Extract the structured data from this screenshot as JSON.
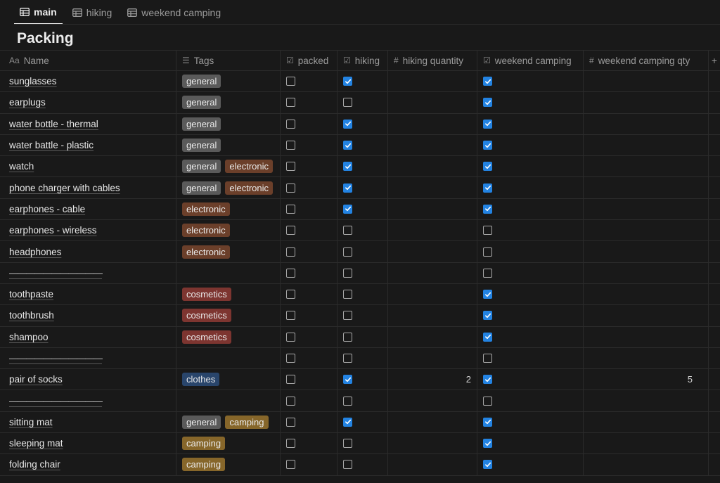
{
  "tabs": [
    {
      "label": "main",
      "icon": "table-icon"
    },
    {
      "label": "hiking",
      "icon": "table-icon"
    },
    {
      "label": "weekend camping",
      "icon": "table-icon"
    }
  ],
  "page": {
    "title": "Packing"
  },
  "columns": {
    "name": "Name",
    "name_icon": "Aa",
    "tags": "Tags",
    "packed": "packed",
    "hiking": "hiking",
    "hiking_qty": "hiking quantity",
    "weekend_camping": "weekend camping",
    "weekend_camping_qty": "weekend camping qty",
    "add": "+"
  },
  "rows": [
    {
      "name": "sunglasses",
      "tags": [
        "general"
      ],
      "packed": false,
      "hiking": true,
      "hiking_qty": "",
      "weekend_camping": true,
      "weekend_camping_qty": ""
    },
    {
      "name": "earplugs",
      "tags": [
        "general"
      ],
      "packed": false,
      "hiking": false,
      "hiking_qty": "",
      "weekend_camping": true,
      "weekend_camping_qty": ""
    },
    {
      "name": "water bottle - thermal",
      "tags": [
        "general"
      ],
      "packed": false,
      "hiking": true,
      "hiking_qty": "",
      "weekend_camping": true,
      "weekend_camping_qty": ""
    },
    {
      "name": "water battle - plastic",
      "tags": [
        "general"
      ],
      "packed": false,
      "hiking": true,
      "hiking_qty": "",
      "weekend_camping": true,
      "weekend_camping_qty": ""
    },
    {
      "name": "watch",
      "tags": [
        "general",
        "electronic"
      ],
      "packed": false,
      "hiking": true,
      "hiking_qty": "",
      "weekend_camping": true,
      "weekend_camping_qty": ""
    },
    {
      "name": "phone charger with cables",
      "tags": [
        "general",
        "electronic"
      ],
      "packed": false,
      "hiking": true,
      "hiking_qty": "",
      "weekend_camping": true,
      "weekend_camping_qty": ""
    },
    {
      "name": "earphones - cable",
      "tags": [
        "electronic"
      ],
      "packed": false,
      "hiking": true,
      "hiking_qty": "",
      "weekend_camping": true,
      "weekend_camping_qty": ""
    },
    {
      "name": "earphones - wireless",
      "tags": [
        "electronic"
      ],
      "packed": false,
      "hiking": false,
      "hiking_qty": "",
      "weekend_camping": false,
      "weekend_camping_qty": ""
    },
    {
      "name": "headphones",
      "tags": [
        "electronic"
      ],
      "packed": false,
      "hiking": false,
      "hiking_qty": "",
      "weekend_camping": false,
      "weekend_camping_qty": ""
    },
    {
      "name": "———————————",
      "sep": true,
      "tags": [],
      "packed": false,
      "hiking": false,
      "hiking_qty": "",
      "weekend_camping": false,
      "weekend_camping_qty": ""
    },
    {
      "name": "toothpaste",
      "tags": [
        "cosmetics"
      ],
      "packed": false,
      "hiking": false,
      "hiking_qty": "",
      "weekend_camping": true,
      "weekend_camping_qty": ""
    },
    {
      "name": "toothbrush",
      "tags": [
        "cosmetics"
      ],
      "packed": false,
      "hiking": false,
      "hiking_qty": "",
      "weekend_camping": true,
      "weekend_camping_qty": ""
    },
    {
      "name": "shampoo",
      "tags": [
        "cosmetics"
      ],
      "packed": false,
      "hiking": false,
      "hiking_qty": "",
      "weekend_camping": true,
      "weekend_camping_qty": ""
    },
    {
      "name": "———————————",
      "sep": true,
      "tags": [],
      "packed": false,
      "hiking": false,
      "hiking_qty": "",
      "weekend_camping": false,
      "weekend_camping_qty": ""
    },
    {
      "name": "pair of socks",
      "tags": [
        "clothes"
      ],
      "packed": false,
      "hiking": true,
      "hiking_qty": "2",
      "weekend_camping": true,
      "weekend_camping_qty": "5"
    },
    {
      "name": "———————————",
      "sep": true,
      "tags": [],
      "packed": false,
      "hiking": false,
      "hiking_qty": "",
      "weekend_camping": false,
      "weekend_camping_qty": ""
    },
    {
      "name": "sitting mat",
      "tags": [
        "general",
        "camping"
      ],
      "packed": false,
      "hiking": true,
      "hiking_qty": "",
      "weekend_camping": true,
      "weekend_camping_qty": ""
    },
    {
      "name": "sleeping mat",
      "tags": [
        "camping"
      ],
      "packed": false,
      "hiking": false,
      "hiking_qty": "",
      "weekend_camping": true,
      "weekend_camping_qty": ""
    },
    {
      "name": "folding chair",
      "tags": [
        "camping"
      ],
      "packed": false,
      "hiking": false,
      "hiking_qty": "",
      "weekend_camping": true,
      "weekend_camping_qty": ""
    }
  ],
  "colors": {
    "checkbox_on": "#2383e2",
    "background": "#191919"
  }
}
